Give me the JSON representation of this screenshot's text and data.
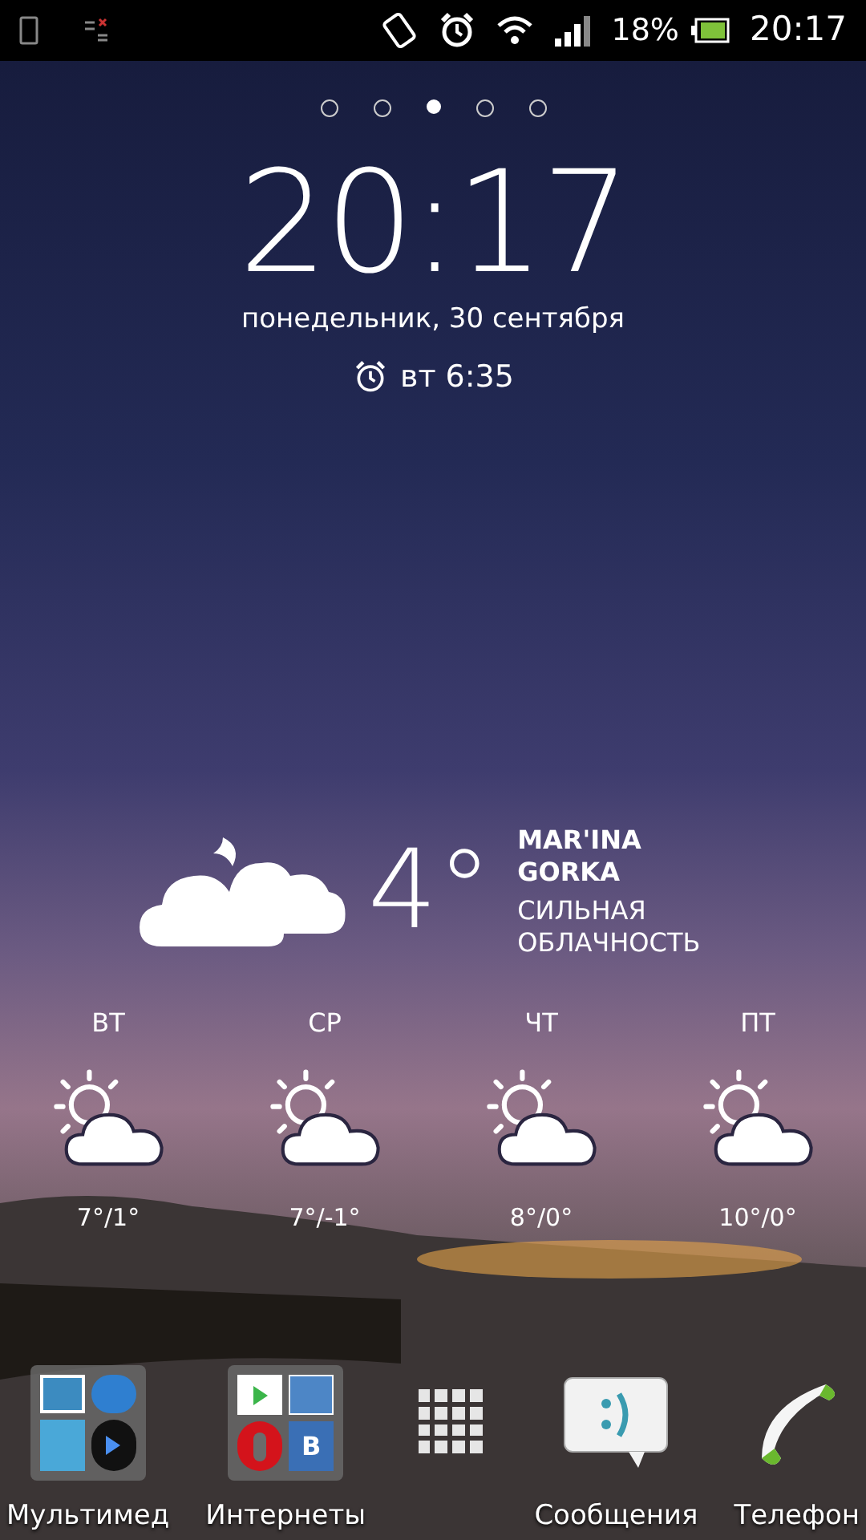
{
  "status_bar": {
    "battery_percent": "18%",
    "time": "20:17"
  },
  "page_indicator": [
    {
      "selected": false
    },
    {
      "selected": false
    },
    {
      "selected": true
    },
    {
      "selected": false
    },
    {
      "selected": false
    }
  ],
  "clock": {
    "time": "20:17",
    "date": "понедельник, 30 сентября",
    "alarm": "вт 6:35"
  },
  "weather": {
    "temperature": "4°",
    "city": "MAR'INA GORKA",
    "condition": "СИЛЬНАЯ ОБЛАЧНОСТЬ"
  },
  "forecast": [
    {
      "day": "ВТ",
      "temps": "7°/1°"
    },
    {
      "day": "СР",
      "temps": "7°/-1°"
    },
    {
      "day": "ЧТ",
      "temps": "8°/0°"
    },
    {
      "day": "ПТ",
      "temps": "10°/0°"
    }
  ],
  "dock": [
    {
      "kind": "media-folder",
      "label": "Мультимед"
    },
    {
      "kind": "internet-folder",
      "label": "Интернеты",
      "badge_letter": "B"
    },
    {
      "kind": "apps"
    },
    {
      "kind": "messages",
      "label": "Сообщения"
    },
    {
      "kind": "phone",
      "label": "Телефон"
    }
  ]
}
